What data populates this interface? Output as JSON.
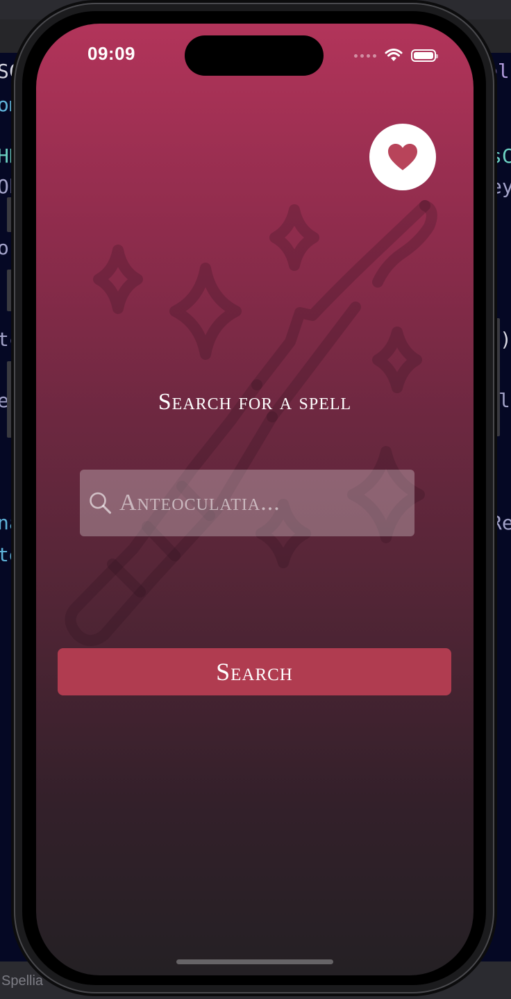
{
  "ide": {
    "bottom_label": "Spellia",
    "fragments_left": [
      "SC",
      "om",
      "HR",
      "Ob",
      "or",
      "tc",
      "ec",
      "na",
      "te"
    ],
    "fragments_right": [
      "el",
      "sC",
      "ey",
      ")",
      "l",
      "Re"
    ]
  },
  "status_bar": {
    "time": "09:09"
  },
  "favorites": {
    "icon": "heart-icon",
    "icon_color": "#b8445a"
  },
  "main": {
    "title": "Search for a spell",
    "search": {
      "placeholder": "Anteoculatia...",
      "value": ""
    },
    "search_button_label": "Search"
  },
  "colors": {
    "gradient_top": "#b2345a",
    "gradient_bottom": "#242024",
    "button": "#b03c50",
    "accent": "#b8445a"
  }
}
